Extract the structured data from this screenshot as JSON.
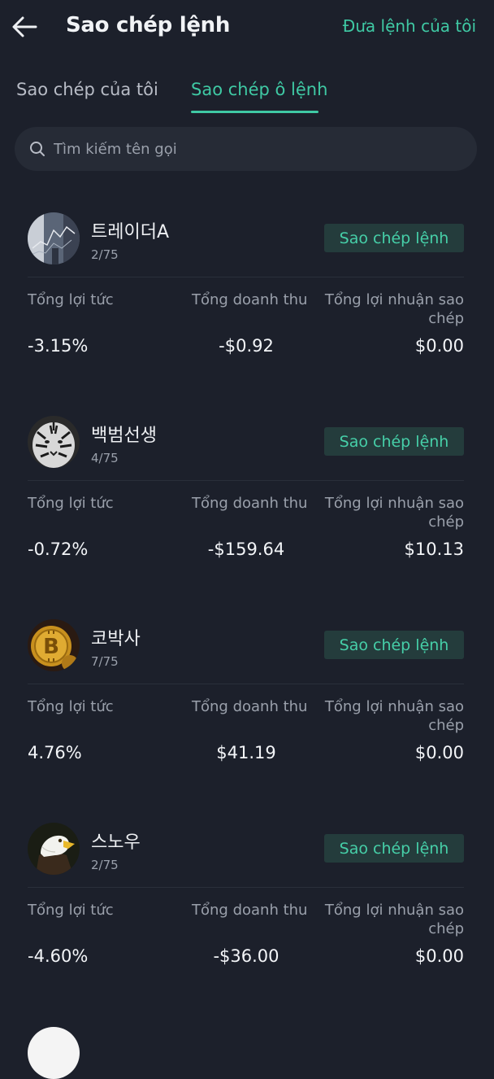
{
  "header": {
    "title": "Sao chép lệnh",
    "action_link": "Đưa lệnh của tôi"
  },
  "tabs": [
    {
      "label": "Sao chép của tôi",
      "active": false
    },
    {
      "label": "Sao chép ô lệnh",
      "active": true
    }
  ],
  "search": {
    "placeholder": "Tìm kiếm tên gọi"
  },
  "labels": {
    "copy_button": "Sao chép lệnh",
    "total_yield": "Tổng lợi tức",
    "total_revenue": "Tổng doanh thu",
    "total_copy_profit": "Tổng lợi nhuận sao chép"
  },
  "traders": [
    {
      "name": "트레이더A",
      "slots": "2/75",
      "yield": "-3.15%",
      "revenue": "-$0.92",
      "copy_profit": "$0.00",
      "avatar": "chart-avatar"
    },
    {
      "name": "백범선생",
      "slots": "4/75",
      "yield": "-0.72%",
      "revenue": "-$159.64",
      "copy_profit": "$10.13",
      "avatar": "tiger-avatar"
    },
    {
      "name": "코박사",
      "slots": "7/75",
      "yield": "4.76%",
      "revenue": "$41.19",
      "copy_profit": "$0.00",
      "avatar": "bitcoin-avatar"
    },
    {
      "name": "스노우",
      "slots": "2/75",
      "yield": "-4.60%",
      "revenue": "-$36.00",
      "copy_profit": "$0.00",
      "avatar": "eagle-avatar"
    }
  ],
  "colors": {
    "background": "#1c202b",
    "accent": "#3fc9a4",
    "button_bg": "#243c3c",
    "muted_text": "#9aa0ab"
  }
}
